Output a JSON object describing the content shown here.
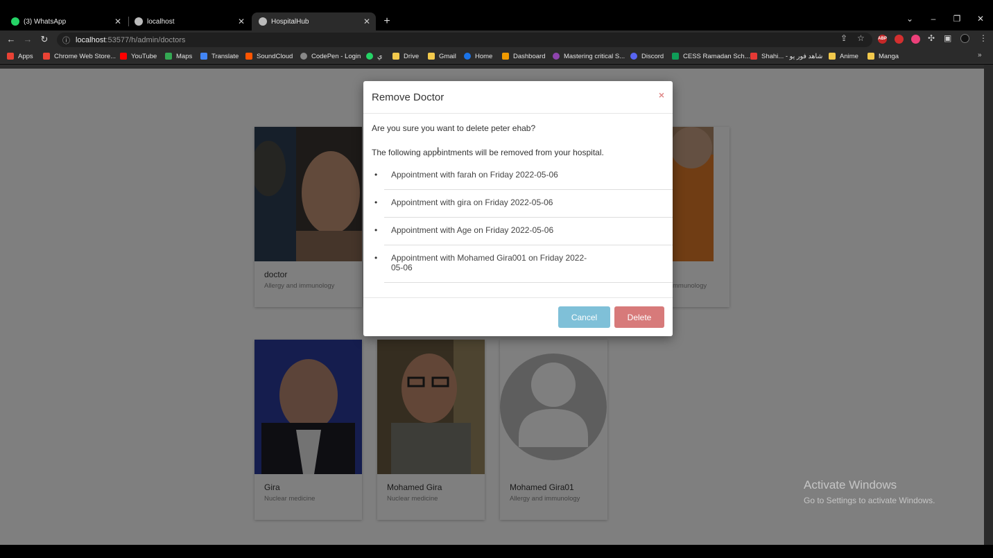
{
  "browser": {
    "tabs": [
      {
        "title": "(3) WhatsApp",
        "icon": "whatsapp-icon",
        "color": "#25d366",
        "active": false
      },
      {
        "title": "localhost",
        "icon": "globe-icon",
        "color": "#bbbbbb",
        "active": false
      },
      {
        "title": "HospitalHub",
        "icon": "globe-icon",
        "color": "#bbbbbb",
        "active": true
      }
    ],
    "new_tab_symbol": "+",
    "url_host": "localhost",
    "url_path": ":53577/h/admin/doctors",
    "bookmarks": [
      {
        "label": "Apps",
        "color": "#e94235"
      },
      {
        "label": "Chrome Web Store...",
        "color": "#ea4335"
      },
      {
        "label": "YouTube",
        "color": "#ff0000"
      },
      {
        "label": "Maps",
        "color": "#34a853"
      },
      {
        "label": "Translate",
        "color": "#4285f4"
      },
      {
        "label": "SoundCloud",
        "color": "#ff5500"
      },
      {
        "label": "CodePen - Login",
        "color": "#888888"
      },
      {
        "label": "ي",
        "color": "#25d366"
      },
      {
        "label": "Drive",
        "color": "#f2c94c"
      },
      {
        "label": "Gmail",
        "color": "#f2c94c"
      },
      {
        "label": "Home",
        "color": "#1a73e8"
      },
      {
        "label": "Dashboard",
        "color": "#f09a00"
      },
      {
        "label": "Mastering critical S...",
        "color": "#8e44ad"
      },
      {
        "label": "Discord",
        "color": "#5865f2"
      },
      {
        "label": "CESS Ramadan Sch...",
        "color": "#0f9d58"
      },
      {
        "label": "Shahi... - شاهد فور يو",
        "color": "#e53935"
      },
      {
        "label": "Anime",
        "color": "#f2c94c"
      },
      {
        "label": "Manga",
        "color": "#f2c94c"
      }
    ],
    "extensions": [
      {
        "label": "ABP",
        "color": "#c62828"
      },
      {
        "label": "",
        "color": "#d32f2f"
      },
      {
        "label": "",
        "color": "#ec407a"
      }
    ]
  },
  "doctors": [
    {
      "name": "doctor",
      "specialty": "Allergy and immunology"
    },
    {
      "name": "",
      "specialty": "Allergy and immunology",
      "visible_text": "mmunology"
    },
    {
      "name": "Gira",
      "specialty": "Nuclear medicine"
    },
    {
      "name": "Mohamed Gira",
      "specialty": "Nuclear medicine"
    },
    {
      "name": "Mohamed Gira01",
      "specialty": "Allergy and immunology"
    }
  ],
  "modal": {
    "title": "Remove Doctor",
    "close_symbol": "×",
    "confirm_text": "Are you sure you want to delete peter ehab?",
    "info_text": "The following appointments will be removed from your hospital.",
    "appointments": [
      "Appointment with farah on Friday 2022-05-06",
      "Appointment with gira on Friday 2022-05-06",
      "Appointment with Age on Friday 2022-05-06",
      "Appointment with Mohamed Gira001 on Friday 2022-05-06"
    ],
    "cancel_label": "Cancel",
    "delete_label": "Delete",
    "cancel_color": "#7fc0d8",
    "delete_color": "#d77a7a"
  },
  "watermark": {
    "line1": "Activate Windows",
    "line2": "Go to Settings to activate Windows."
  }
}
